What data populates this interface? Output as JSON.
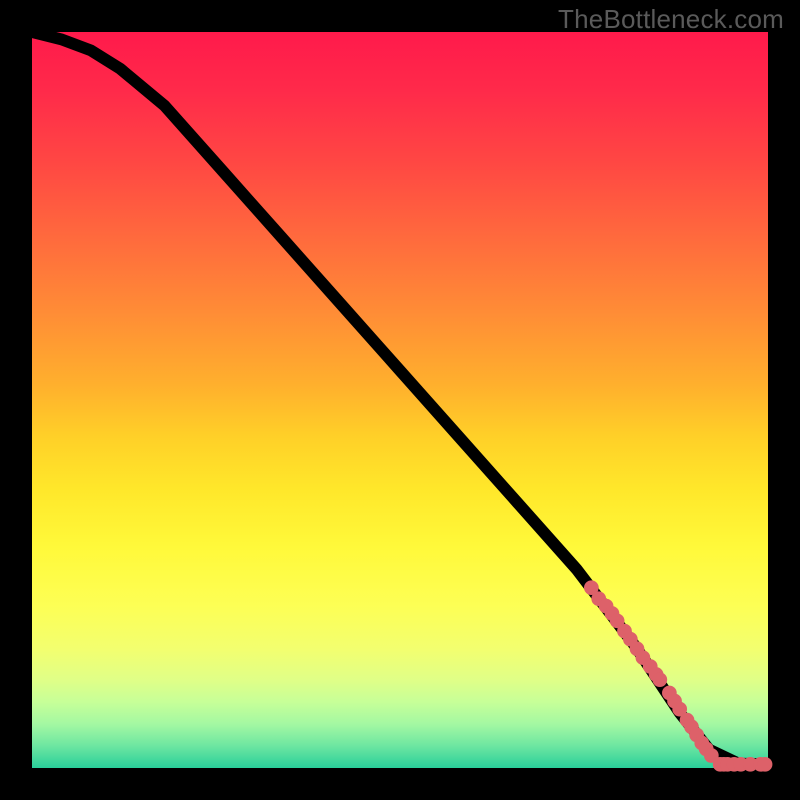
{
  "watermark": "TheBottleneck.com",
  "colors": {
    "dot": "#dd6169",
    "line": "#000000",
    "frame": "#000000"
  },
  "chart_data": {
    "type": "line",
    "title": "",
    "xlabel": "",
    "ylabel": "",
    "xlim": [
      0,
      100
    ],
    "ylim": [
      0,
      100
    ],
    "grid": false,
    "legend": false,
    "series": [
      {
        "name": "curve",
        "x": [
          0,
          4,
          8,
          12,
          18,
          26,
          34,
          42,
          50,
          58,
          66,
          74,
          82,
          88,
          92,
          96,
          100
        ],
        "y": [
          100,
          99,
          97.5,
          95,
          90,
          81,
          72,
          63,
          54,
          45,
          36,
          27,
          16.5,
          7.5,
          2.5,
          0.6,
          0.5
        ]
      }
    ],
    "points": [
      {
        "x": 76.0,
        "y": 24.5
      },
      {
        "x": 77.0,
        "y": 23.0
      },
      {
        "x": 78.0,
        "y": 22.0
      },
      {
        "x": 78.8,
        "y": 21.0
      },
      {
        "x": 79.5,
        "y": 20.0
      },
      {
        "x": 80.5,
        "y": 18.6
      },
      {
        "x": 81.3,
        "y": 17.5
      },
      {
        "x": 82.2,
        "y": 16.2
      },
      {
        "x": 83.0,
        "y": 15.0
      },
      {
        "x": 84.0,
        "y": 13.8
      },
      {
        "x": 84.8,
        "y": 12.7
      },
      {
        "x": 85.3,
        "y": 12.0
      },
      {
        "x": 86.6,
        "y": 10.2
      },
      {
        "x": 87.3,
        "y": 9.1
      },
      {
        "x": 88.0,
        "y": 8.0
      },
      {
        "x": 89.0,
        "y": 6.5
      },
      {
        "x": 89.6,
        "y": 5.6
      },
      {
        "x": 90.3,
        "y": 4.5
      },
      {
        "x": 91.0,
        "y": 3.4
      },
      {
        "x": 91.6,
        "y": 2.6
      },
      {
        "x": 92.3,
        "y": 1.7
      },
      {
        "x": 93.5,
        "y": 0.5
      },
      {
        "x": 94.0,
        "y": 0.5
      },
      {
        "x": 94.5,
        "y": 0.5
      },
      {
        "x": 95.4,
        "y": 0.5
      },
      {
        "x": 96.3,
        "y": 0.5
      },
      {
        "x": 97.6,
        "y": 0.5
      },
      {
        "x": 99.0,
        "y": 0.5
      },
      {
        "x": 99.6,
        "y": 0.5
      }
    ],
    "point_radius": 1.0
  }
}
